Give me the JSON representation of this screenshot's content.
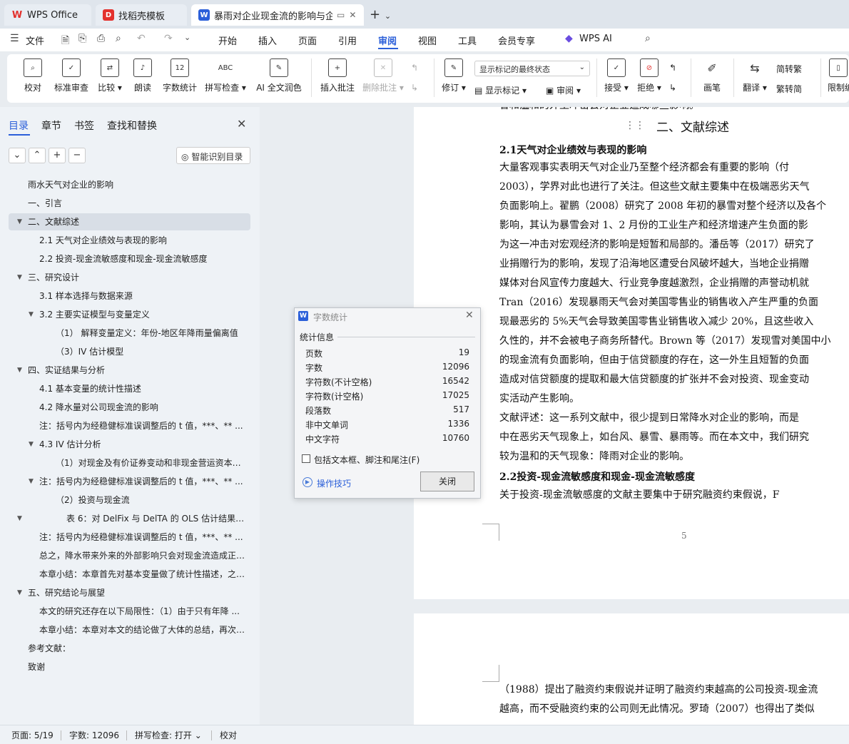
{
  "tabs": {
    "wps": "WPS Office",
    "daoke": "找稻壳模板",
    "doc": "暴雨对企业现金流的影响与企业"
  },
  "menu": {
    "file": "文件",
    "items": [
      "开始",
      "插入",
      "页面",
      "引用",
      "审阅",
      "视图",
      "工具",
      "会员专享"
    ],
    "active": "审阅",
    "ai": "WPS AI"
  },
  "ribbon": {
    "proofread": "校对",
    "standard_review": "标准审查",
    "compare": "比较",
    "read_aloud": "朗读",
    "word_count": "字数统计",
    "spell_check": "拼写检查",
    "ai_polish": "AI 全文润色",
    "insert_comment": "插入批注",
    "delete_comment": "删除批注",
    "track": "修订",
    "markup_select": "显示标记的最终状态",
    "show_markup": "显示标记",
    "review": "审阅",
    "accept": "接受",
    "reject": "拒绝",
    "pen": "画笔",
    "translate": "翻译",
    "to_traditional": "简转繁",
    "to_simplified": "繁转简",
    "restrict": "限制编"
  },
  "nav": {
    "tabs": [
      "目录",
      "章节",
      "书签",
      "查找和替换"
    ],
    "smart_btn": "智能识别目录",
    "toc": [
      "雨水天气对企业的影响",
      "一、引言",
      "二、文献综述",
      "2.1 天气对企业绩效与表现的影响",
      "2.2 投资-现金流敏感度和现金-现金流敏感度",
      "三、研究设计",
      "3.1  样本选择与数据来源",
      "3.2  主要实证模型与变量定义",
      "（1）   解释变量定义：年份-地区年降雨量偏离值",
      "（3）IV 估计模型",
      "四、实证结果与分析",
      "4.1 基本变量的统计性描述",
      "4.2 降水量对公司现金流的影响",
      "注：括号内为经稳健标准误调整后的 t 值，***、** ...",
      "4.3 IV 估计分析",
      "（1）对现金及有价证券变动和非现金营运资本变 ...",
      "注：括号内为经稳健标准误调整后的 t 值，***、** ...",
      "（2）投资与现金流",
      "表 6：对 DelFix 与 DelTA 的 OLS 估计结果 ...",
      "注：括号内为经稳健标准误调整后的 t 值，***、** ...",
      "总之，降水带来外来的外部影响只会对现金流造成正 ...",
      "本章小结：本章首先对基本变量做了统计性描述，之 ...",
      "五、研究结论与展望",
      "本文的研究还存在以下局限性：（1）由于只有年降 ...",
      "本章小结：本章对本文的结论做了大体的总结，再次 ...",
      "参考文献：",
      "致谢"
    ]
  },
  "doc": {
    "top_line": "香和温和的外生冲击会对企业造成哪些影响。",
    "heading2": "二、文献综述",
    "h21": "2.1天气对企业绩效与表现的影响",
    "p1": [
      "    大量客观事实表明天气对企业乃至整个经济都会有重要的影响（付",
      "2003），学界对此也进行了关注。但这些文献主要集中在极端恶劣天气",
      "负面影响上。翟鹏（2008）研究了 2008 年初的暴雪对整个经济以及各个",
      "影响，其认为暴雪会对 1、2 月份的工业生产和经济增速产生负面的影",
      "为这一冲击对宏观经济的影响是短暂和局部的。潘岳等（2017）研究了",
      "业捐赠行为的影响，发现了沿海地区遭受台风破坏越大，当地企业捐赠",
      "媒体对台风宣传力度越大、行业竞争度越激烈，企业捐赠的声誉动机就",
      "Tran（2016）发现暴雨天气会对美国零售业的销售收入产生严重的负面",
      "现最恶劣的 5%天气会导致美国零售业销售收入减少 20%，且这些收入",
      "久性的，并不会被电子商务所替代。Brown 等（2017）发现雪对美国中小",
      "的现金流有负面影响，但由于信贷额度的存在，这一外生且短暂的负面",
      "造成对信贷额度的提取和最大信贷额度的扩张并不会对投资、现金变动",
      "实活动产生影响。"
    ],
    "p2": [
      "    文献评述：这一系列文献中，很少提到日常降水对企业的影响，而是",
      "中在恶劣天气现象上，如台风、暴雪、暴雨等。而在本文中，我们研究",
      "较为温和的天气现象：降雨对企业的影响。"
    ],
    "h22": "2.2投资-现金流敏感度和现金-现金流敏感度",
    "p3": "    关于投资-现金流敏感度的文献主要集中于研究融资约束假说，F",
    "page_number": "5",
    "p4": [
      "（1988）提出了融资约束假说并证明了融资约束越高的公司投资-现金流",
      "越高，而不受融资约束的公司则无此情况。罗琦（2007）也得出了类似"
    ]
  },
  "status": {
    "page": "页面: 5/19",
    "words": "字数: 12096",
    "spell": "拼写检查: 打开",
    "proof": "校对"
  },
  "dialog": {
    "title": "字数统计",
    "section": "统计信息",
    "rows": [
      {
        "label": "页数",
        "value": "19"
      },
      {
        "label": "字数",
        "value": "12096"
      },
      {
        "label": "字符数(不计空格)",
        "value": "16542"
      },
      {
        "label": "字符数(计空格)",
        "value": "17025"
      },
      {
        "label": "段落数",
        "value": "517"
      },
      {
        "label": "非中文单词",
        "value": "1336"
      },
      {
        "label": "中文字符",
        "value": "10760"
      }
    ],
    "checkbox_label": "包括文本框、脚注和尾注(F)",
    "tips": "操作技巧",
    "close_btn": "关闭"
  },
  "colors": {
    "accent": "#2b5fd9",
    "wps_red": "#e3312d"
  }
}
